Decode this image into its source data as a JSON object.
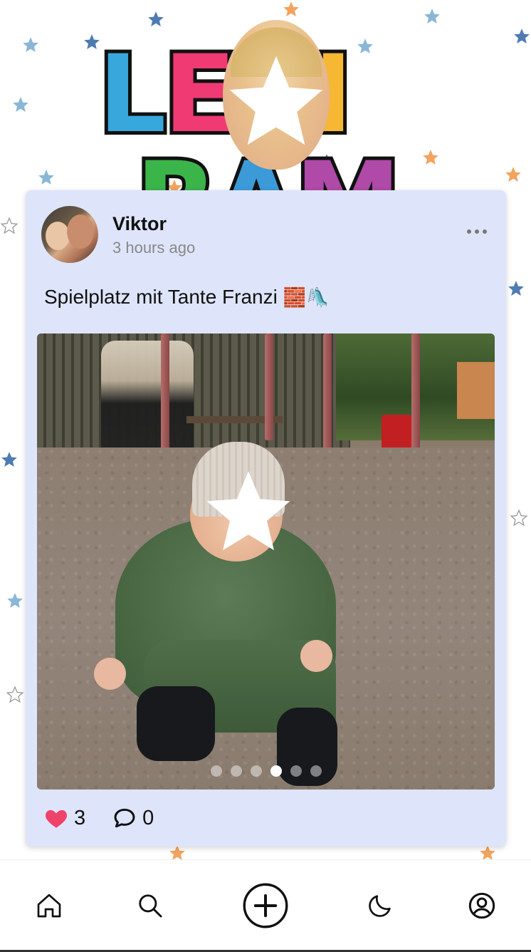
{
  "app": {
    "name": "Levigram",
    "logo_letters_left": [
      "L",
      "E",
      "V",
      "I"
    ],
    "logo_letters_right": [
      "R",
      "A",
      "M"
    ],
    "logo_colors": [
      "#38a7dc",
      "#f03a73",
      "#f6803a",
      "#f6b733",
      "#3bb54a",
      "#3c9ad9",
      "#b04aa8"
    ]
  },
  "post": {
    "author": "Viktor",
    "time": "3 hours ago",
    "caption": "Spielplatz mit Tante Franzi",
    "caption_emoji": "🧱🛝",
    "image_count": 6,
    "active_image_index": 3,
    "likes": "3",
    "comments": "0",
    "like_color": "#f0436a"
  },
  "nav": {
    "items": [
      {
        "name": "home",
        "icon": "home-icon"
      },
      {
        "name": "search",
        "icon": "search-icon"
      },
      {
        "name": "create",
        "icon": "plus-circle-icon"
      },
      {
        "name": "night-mode",
        "icon": "moon-icon"
      },
      {
        "name": "profile",
        "icon": "user-circle-icon"
      }
    ]
  },
  "theme": {
    "card_bg": "#dee5fa",
    "star_blue": "#5b8fc8",
    "star_orange": "#f2a45e"
  }
}
